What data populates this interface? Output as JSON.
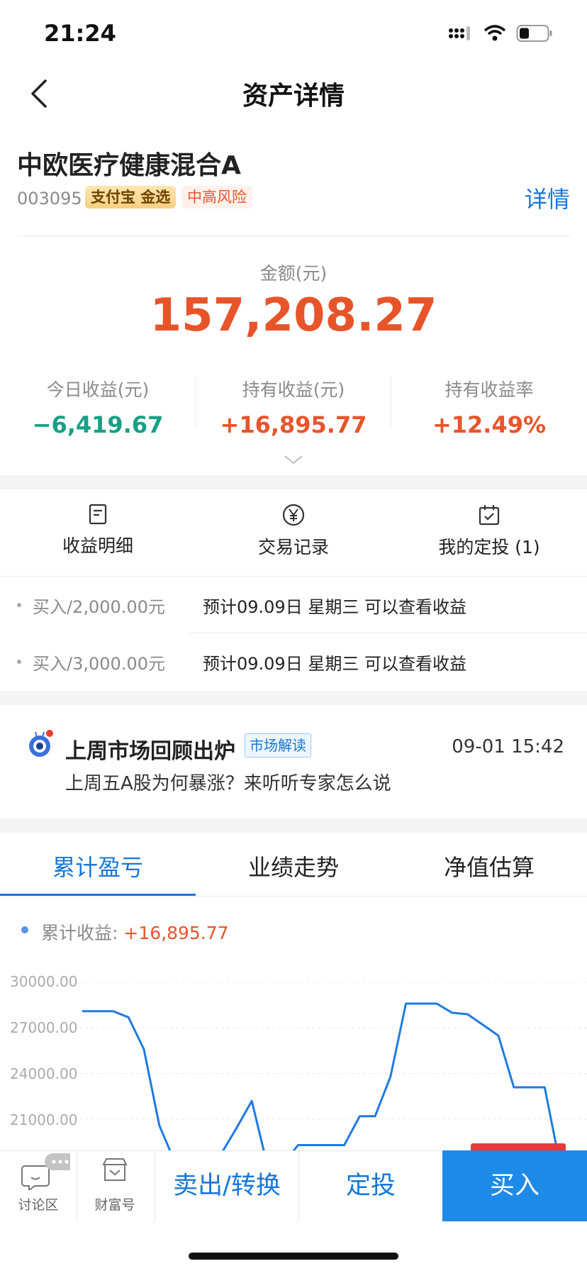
{
  "status_bar": {
    "time": "21:24"
  },
  "nav": {
    "title": "资产详情"
  },
  "fund": {
    "name": "中欧医疗健康混合A",
    "code": "003095",
    "badge": "支付宝 金选",
    "risk": "中高风险",
    "detail_link": "详情"
  },
  "amount": {
    "label": "金额(元)",
    "value": "157,208.27"
  },
  "stats": [
    {
      "label": "今日收益(元)",
      "value": "−6,419.67",
      "color": "#16a085"
    },
    {
      "label": "持有收益(元)",
      "value": "+16,895.77",
      "color": "#e8542a"
    },
    {
      "label": "持有收益率",
      "value": "+12.49%",
      "color": "#e8542a"
    }
  ],
  "actions": [
    {
      "label": "收益明细",
      "icon": "document-icon"
    },
    {
      "label": "交易记录",
      "icon": "yen-circle-icon"
    },
    {
      "label": "我的定投 (1)",
      "icon": "calendar-check-icon"
    }
  ],
  "pending": [
    {
      "amount": "买入/2,000.00元",
      "hint": "预计09.09日 星期三 可以查看收益"
    },
    {
      "amount": "买入/3,000.00元",
      "hint": "预计09.09日 星期三 可以查看收益"
    }
  ],
  "news": {
    "title": "上周市场回顾出炉",
    "tag": "市场解读",
    "time": "09-01 15:42",
    "subtitle": "上周五A股为何暴涨？来听听专家怎么说"
  },
  "tabs": [
    "累计盈亏",
    "业绩走势",
    "净值估算"
  ],
  "legend": {
    "label": "累计收益: ",
    "value": "+16,895.77"
  },
  "chart_data": {
    "type": "line",
    "y_ticks": [
      "30000.00",
      "27000.00",
      "24000.00",
      "21000.00"
    ],
    "ylim": [
      18000,
      30000
    ],
    "series": [
      {
        "color": "#1f7ae0",
        "values": [
          28100,
          28100,
          28100,
          27700,
          25600,
          20600,
          18200,
          18000,
          18000,
          18700,
          20400,
          22200,
          18000,
          18000,
          19300,
          19300,
          19300,
          19300,
          21200,
          21200,
          23800,
          28600,
          28600,
          28600,
          28000,
          27900,
          27200,
          26500,
          23100,
          23100,
          23100,
          18000
        ]
      }
    ]
  },
  "bottom": {
    "discussion": "讨论区",
    "wealth": "财富号",
    "sell": "卖出/转换",
    "fixed": "定投",
    "buy": "买入"
  }
}
